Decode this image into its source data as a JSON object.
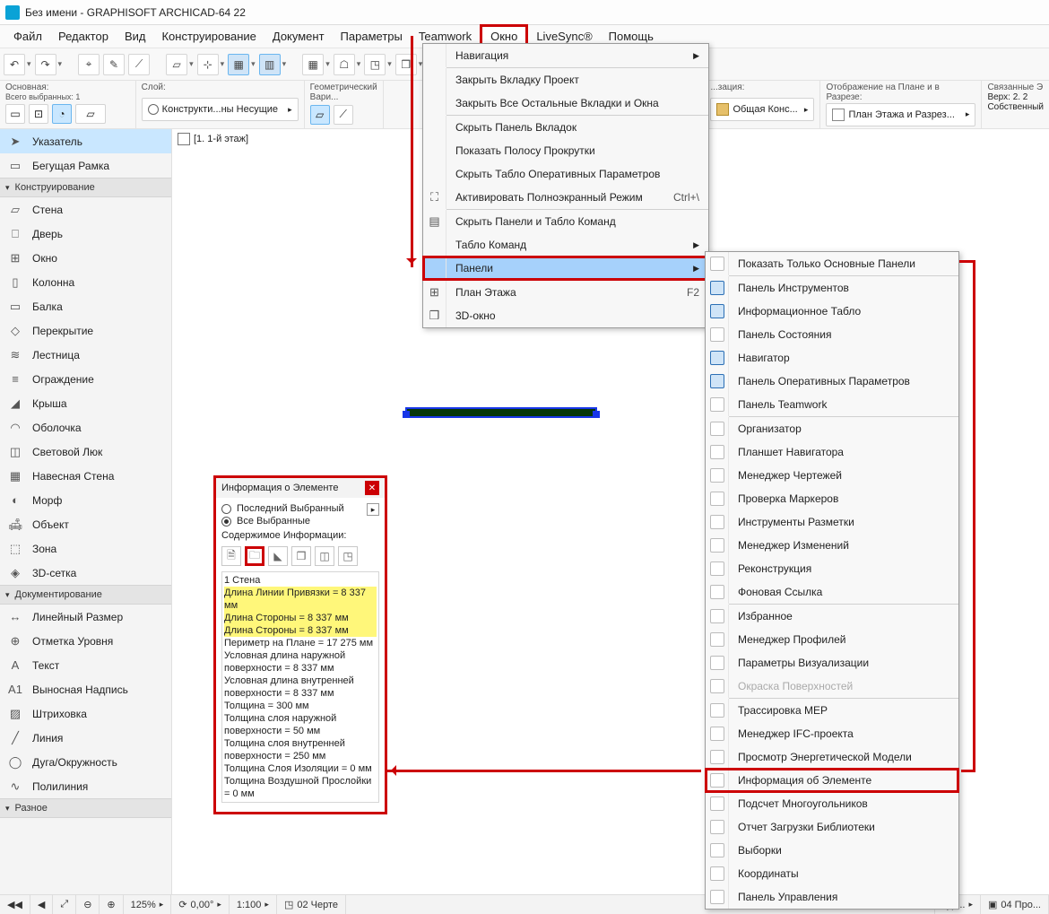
{
  "title": "Без имени - GRAPHISOFT ARCHICAD-64 22",
  "menubar": [
    "Файл",
    "Редактор",
    "Вид",
    "Конструирование",
    "Документ",
    "Параметры",
    "Teamwork",
    "Окно",
    "LiveSync®",
    "Помощь"
  ],
  "menubar_hl_idx": 7,
  "props": {
    "main": {
      "label": "Основная:",
      "sub": "Всего выбранных: 1"
    },
    "layer": {
      "label": "Слой:",
      "value": "Конструкти...ны Несущие"
    },
    "geom": {
      "label": "Геометрический Вари..."
    },
    "rep": {
      "label": "...зация:",
      "value": "Общая Конс..."
    },
    "disp": {
      "label": "Отображение на Плане и в Разрезе:",
      "value": "План Этажа и Разрез..."
    },
    "link": {
      "label": "Связанные Э",
      "ver_lbl": "Верх:",
      "ver_val": "2. 2",
      "own": "Собственный"
    }
  },
  "palette": {
    "top": [
      {
        "label": "Указатель",
        "sel": true,
        "glyph": "➤"
      },
      {
        "label": "Бегущая Рамка",
        "sel": false,
        "glyph": "▭"
      }
    ],
    "groups": [
      {
        "header": "Конструирование",
        "items": [
          {
            "label": "Стена",
            "glyph": "▱"
          },
          {
            "label": "Дверь",
            "glyph": "⎕"
          },
          {
            "label": "Окно",
            "glyph": "⊞"
          },
          {
            "label": "Колонна",
            "glyph": "▯"
          },
          {
            "label": "Балка",
            "glyph": "▭"
          },
          {
            "label": "Перекрытие",
            "glyph": "◇"
          },
          {
            "label": "Лестница",
            "glyph": "≋"
          },
          {
            "label": "Ограждение",
            "glyph": "≡"
          },
          {
            "label": "Крыша",
            "glyph": "◢"
          },
          {
            "label": "Оболочка",
            "glyph": "◠"
          },
          {
            "label": "Световой Люк",
            "glyph": "◫"
          },
          {
            "label": "Навесная Стена",
            "glyph": "▦"
          },
          {
            "label": "Морф",
            "glyph": "◐"
          },
          {
            "label": "Объект",
            "glyph": "🛋"
          },
          {
            "label": "Зона",
            "glyph": "⬚"
          },
          {
            "label": "3D-сетка",
            "glyph": "◈"
          }
        ]
      },
      {
        "header": "Документирование",
        "items": [
          {
            "label": "Линейный Размер",
            "glyph": "↔"
          },
          {
            "label": "Отметка Уровня",
            "glyph": "⊕"
          },
          {
            "label": "Текст",
            "glyph": "A"
          },
          {
            "label": "Выносная Надпись",
            "glyph": "A1"
          },
          {
            "label": "Штриховка",
            "glyph": "▨"
          },
          {
            "label": "Линия",
            "glyph": "╱"
          },
          {
            "label": "Дуга/Окружность",
            "glyph": "◯"
          },
          {
            "label": "Полилиния",
            "glyph": "∿"
          }
        ]
      },
      {
        "header": "Разное",
        "items": []
      }
    ]
  },
  "canvas": {
    "tab": "[1. 1-й этаж]"
  },
  "dropdown": [
    {
      "type": "row",
      "label": "Навигация",
      "arrow": true
    },
    {
      "type": "sep"
    },
    {
      "type": "row",
      "label": "Закрыть Вкладку Проект"
    },
    {
      "type": "row",
      "label": "Закрыть Все Остальные Вкладки и Окна"
    },
    {
      "type": "sep"
    },
    {
      "type": "row",
      "label": "Скрыть Панель Вкладок"
    },
    {
      "type": "row",
      "label": "Показать Полосу Прокрутки"
    },
    {
      "type": "row",
      "label": "Скрыть Табло Оперативных Параметров"
    },
    {
      "type": "row",
      "label": "Активировать Полноэкранный Режим",
      "shortcut": "Ctrl+\\",
      "icon": "⛶"
    },
    {
      "type": "sep"
    },
    {
      "type": "row",
      "label": "Скрыть Панели и Табло Команд",
      "icon": "▤"
    },
    {
      "type": "row",
      "label": "Табло Команд",
      "arrow": true
    },
    {
      "type": "row",
      "label": "Панели",
      "arrow": true,
      "sel": true,
      "framed": true
    },
    {
      "type": "sep"
    },
    {
      "type": "row",
      "label": "План Этажа",
      "shortcut": "F2",
      "icon": "⊞"
    },
    {
      "type": "row",
      "label": "3D-окно",
      "icon": "❒"
    }
  ],
  "submenu": [
    {
      "label": "Показать Только Основные Панели"
    },
    {
      "type": "sep"
    },
    {
      "label": "Панель Инструментов",
      "lit": true
    },
    {
      "label": "Информационное Табло",
      "lit": true
    },
    {
      "label": "Панель Состояния"
    },
    {
      "label": "Навигатор",
      "lit": true
    },
    {
      "label": "Панель Оперативных Параметров",
      "lit": true
    },
    {
      "label": "Панель Teamwork"
    },
    {
      "type": "sep"
    },
    {
      "label": "Организатор"
    },
    {
      "label": "Планшет Навигатора"
    },
    {
      "label": "Менеджер Чертежей"
    },
    {
      "label": "Проверка Маркеров"
    },
    {
      "label": "Инструменты Разметки"
    },
    {
      "label": "Менеджер Изменений"
    },
    {
      "label": "Реконструкция"
    },
    {
      "label": "Фоновая Ссылка"
    },
    {
      "type": "sep"
    },
    {
      "label": "Избранное"
    },
    {
      "label": "Менеджер Профилей"
    },
    {
      "label": "Параметры Визуализации"
    },
    {
      "label": "Окраска Поверхностей",
      "disabled": true
    },
    {
      "type": "sep"
    },
    {
      "label": "Трассировка MEP"
    },
    {
      "label": "Менеджер IFC-проекта"
    },
    {
      "label": "Просмотр Энергетической Модели"
    },
    {
      "label": "Информация об Элементе",
      "framed": true
    },
    {
      "label": "Подсчет Многоугольников"
    },
    {
      "label": "Отчет Загрузки Библиотеки"
    },
    {
      "label": "Выборки"
    },
    {
      "label": "Координаты"
    },
    {
      "label": "Панель Управления"
    }
  ],
  "info_panel": {
    "title": "Информация о Элементе",
    "radio1": "Последний Выбранный",
    "radio2": "Все Выбранные",
    "content_label": "Содержимое Информации:",
    "header": "1 Стена",
    "hl": [
      "Длина Линии Привязки = 8 337 мм",
      "Длина Стороны = 8 337 мм",
      "Длина Стороны = 8 337 мм"
    ],
    "lines": [
      "Периметр на Плане = 17 275 мм",
      "Условная длина наружной поверхности = 8 337 мм",
      "Условная длина внутренней поверхности = 8 337 мм",
      "Толщина = 300 мм",
      "Толщина слоя наружной поверхности = 50 мм",
      "Толщина слоя внутренней поверхности = 250 мм",
      "Толщина Слоя Изоляции = 0 мм",
      "Толщина Воздушной Прослойки = 0 мм"
    ]
  },
  "statusbar": {
    "zoom": "125%",
    "angle": "0,00°",
    "scale": "1:100",
    "view": "02 Черте",
    "view2": "04 Про..."
  }
}
